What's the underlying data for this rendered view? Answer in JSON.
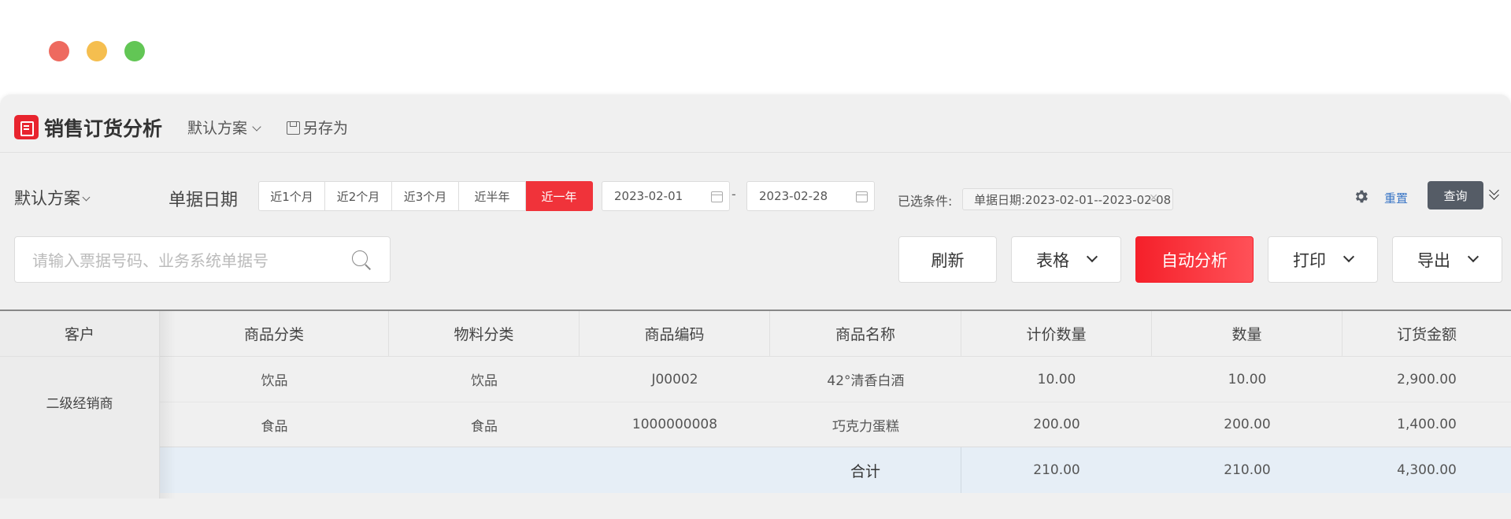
{
  "window_controls": {
    "close": "#ee6a5f",
    "minimize": "#f5be4f",
    "maximize": "#62c655"
  },
  "header": {
    "title": "销售订货分析",
    "plan_select": "默认方案",
    "save_as": "另存为"
  },
  "filter": {
    "plan_select": "默认方案",
    "date_label": "单据日期",
    "quick_ranges": [
      "近1个月",
      "近2个月",
      "近3个月",
      "近半年",
      "近一年"
    ],
    "active_range": "近一年",
    "start_date": "2023-02-01",
    "end_date": "2023-02-28",
    "date_separator": "-",
    "conditions_label": "已选条件:",
    "condition_tag": "单据日期:2023-02-01--2023-02-08",
    "reset": "重置",
    "query": "查询"
  },
  "search": {
    "placeholder": "请输入票据号码、业务系统单据号"
  },
  "toolbar": {
    "refresh": "刷新",
    "table": "表格",
    "auto_analysis": "自动分析",
    "print": "打印",
    "export": "导出"
  },
  "table": {
    "columns": [
      "客户",
      "商品分类",
      "物料分类",
      "商品编码",
      "商品名称",
      "计价数量",
      "数量",
      "订货金额"
    ],
    "customer": "二级经销商",
    "rows": [
      [
        "饮品",
        "饮品",
        "J00002",
        "42°清香白酒",
        "10.00",
        "10.00",
        "2,900.00"
      ],
      [
        "食品",
        "食品",
        "1000000008",
        "巧克力蛋糕",
        "200.00",
        "200.00",
        "1,400.00"
      ]
    ],
    "total": {
      "label": "合计",
      "price_qty": "210.00",
      "qty": "210.00",
      "amount": "4,300.00"
    }
  },
  "colors": {
    "accent": "#f0333a",
    "query_button": "#555c66",
    "link": "#3a76c6"
  }
}
